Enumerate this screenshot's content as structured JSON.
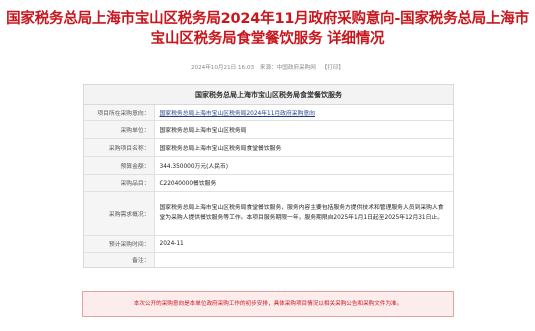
{
  "title_line1": "国家税务总局上海市宝山区税务局2024年11月政府采购意向-国家税务总局上海市",
  "title_line2": "宝山区税务局食堂餐饮服务 详细情况",
  "meta": {
    "datetime": "2024年10月21日 16:03",
    "source": "来源：中国政府采购网",
    "print": "【打印】"
  },
  "table": {
    "heading": "国家税务总局上海市宝山区税务局食堂餐饮服务",
    "rows": [
      {
        "label": "项目所在采购意向：",
        "value": "国家税务总局上海市宝山区税务局2024年11月政府采购意向"
      },
      {
        "label": "采购单位：",
        "value": "国家税务总局上海市宝山区税务局"
      },
      {
        "label": "采购项目名称：",
        "value": "国家税务总局上海市宝山区税务局食堂餐饮服务"
      },
      {
        "label": "预算金额：",
        "value": "344.350000万元(人民币)"
      },
      {
        "label": "采购品目：",
        "value": "C22040000餐饮服务"
      },
      {
        "label": "采购需求概况：",
        "value": "国家税务总局上海市宝山区税务局食堂餐饮服务，服务内容主要包括服务方提供技术和管理服务人员到采购人食堂为采购人提供餐饮服务等工作。本项目服务期限一年，服务期限自2025年1月1日起至2025年12月31日止。"
      },
      {
        "label": "预计采购时间：",
        "value": "2024-11"
      },
      {
        "label": "备注：",
        "value": ""
      }
    ]
  },
  "notice": "本次公开的采购意向是本单位政府采购工作的初步安排，具体采购项目情况以相关采购公告和采购文件为准。",
  "colors": {
    "title": "#c8161d",
    "link": "#1f3e8a",
    "notice_bg": "#fdecec"
  }
}
